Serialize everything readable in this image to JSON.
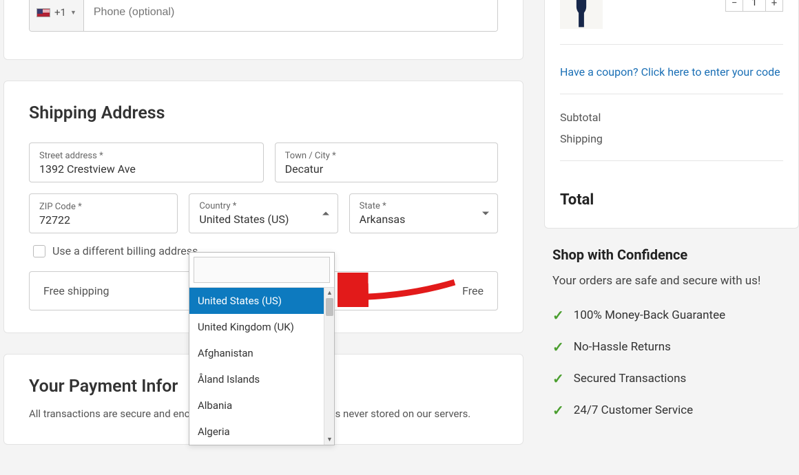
{
  "phone": {
    "prefix": "+1",
    "placeholder": "Phone (optional)"
  },
  "shipping": {
    "heading": "Shipping Address",
    "street": {
      "label": "Street address *",
      "value": "1392 Crestview Ave"
    },
    "city": {
      "label": "Town / City *",
      "value": "Decatur"
    },
    "zip": {
      "label": "ZIP Code *",
      "value": "72722"
    },
    "country": {
      "label": "Country *",
      "value": "United States (US)"
    },
    "state": {
      "label": "State *",
      "value": "Arkansas"
    },
    "diff_billing": "Use a different billing address",
    "ship_option": "Free shipping",
    "ship_price": "Free"
  },
  "country_options": [
    "United States (US)",
    "United Kingdom (UK)",
    "Afghanistan",
    "Åland Islands",
    "Albania",
    "Algeria"
  ],
  "payment": {
    "heading": "Your Payment Infor",
    "desc": "All transactions are secure and encrypted. Credit card information is never stored on our servers."
  },
  "summary": {
    "qty": "1",
    "coupon": "Have a coupon? Click here to enter your code",
    "subtotal_label": "Subtotal",
    "shipping_label": "Shipping",
    "total_label": "Total"
  },
  "confidence": {
    "heading": "Shop with Confidence",
    "sub": "Your orders are safe and secure with us!",
    "items": [
      "100% Money-Back Guarantee",
      "No-Hassle Returns",
      "Secured Transactions",
      "24/7 Customer Service"
    ]
  }
}
